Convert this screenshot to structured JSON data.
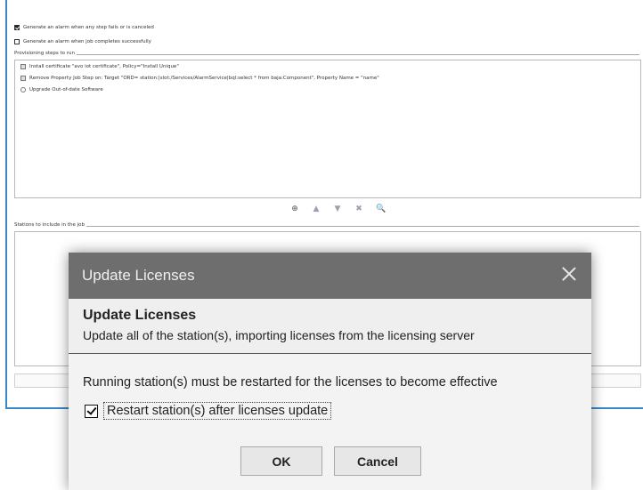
{
  "background": {
    "options": [
      {
        "label": "Generate an alarm when any step fails or is canceled",
        "checked": true
      },
      {
        "label": "Generate an alarm when job completes successfully",
        "checked": false
      }
    ],
    "steps_section_label": "Provisioning steps to run",
    "steps": [
      {
        "icon": "certificate-icon",
        "label": "Install certificate \"avo iot certificate\", Policy=\"Install Unique\""
      },
      {
        "icon": "property-icon",
        "label": "Remove Property Job Step on: Target \"ORD= station:|slot:/Services/AlarmService|bql:select * from baja:Component\", Property Name = \"name\""
      },
      {
        "icon": "refresh-icon",
        "label": "Upgrade Out-of-date Software"
      }
    ],
    "toolbar": [
      "⊕",
      "▲",
      "▼",
      "✖",
      "🔍"
    ],
    "stations_section_label": "Stations to include in the job"
  },
  "dialog": {
    "title": "Update Licenses",
    "header_title": "Update Licenses",
    "header_description": "Update all of the station(s), importing licenses from the licensing server",
    "message": "Running station(s) must be restarted for the licenses to become effective",
    "restart_checkbox_label": "Restart station(s) after licenses update",
    "restart_checked": true,
    "ok_label": "OK",
    "cancel_label": "Cancel"
  },
  "colors": {
    "titlebar": "#6e6e6e",
    "window_border": "#3b86c5",
    "dialog_bg": "#f3f3f3"
  }
}
